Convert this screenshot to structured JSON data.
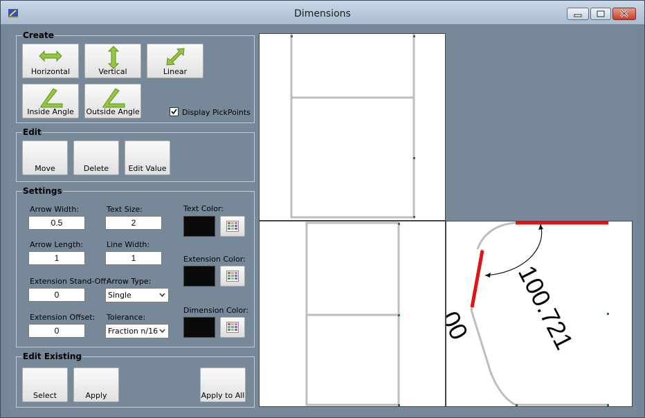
{
  "window": {
    "title": "Dimensions"
  },
  "create": {
    "legend": "Create",
    "horizontal": "Horizontal",
    "vertical": "Vertical",
    "linear": "Linear",
    "inside_angle": "Inside Angle",
    "outside_angle": "Outside Angle",
    "display_pickpoints": {
      "label": "Display PickPoints",
      "checked": true
    }
  },
  "edit": {
    "legend": "Edit",
    "move": "Move",
    "delete": "Delete",
    "edit_value": "Edit Value"
  },
  "settings": {
    "legend": "Settings",
    "arrow_width": {
      "label": "Arrow Width:",
      "value": "0.5"
    },
    "text_size": {
      "label": "Text Size:",
      "value": "2"
    },
    "arrow_length": {
      "label": "Arrow Length:",
      "value": "1"
    },
    "line_width": {
      "label": "Line Width:",
      "value": "1"
    },
    "extension_standoff": {
      "label": "Extension Stand-Off:",
      "value": "0"
    },
    "arrow_type": {
      "label": "Arrow Type:",
      "value": "Single"
    },
    "extension_offset": {
      "label": "Extension Offset:",
      "value": "0"
    },
    "tolerance": {
      "label": "Tolerance:",
      "value": "Fraction n/16"
    },
    "text_color": {
      "label": "Text Color:",
      "color": "#0a0a0a"
    },
    "extension_color": {
      "label": "Extension Color:",
      "color": "#0a0a0a"
    },
    "dimension_color": {
      "label": "Dimension Color:",
      "color": "#0a0a0a"
    }
  },
  "edit_existing": {
    "legend": "Edit Existing",
    "select": "Select",
    "apply": "Apply",
    "apply_to_all": "Apply to All"
  },
  "viewports": {
    "dimension_value": "100.721",
    "partial_value": "00"
  }
}
